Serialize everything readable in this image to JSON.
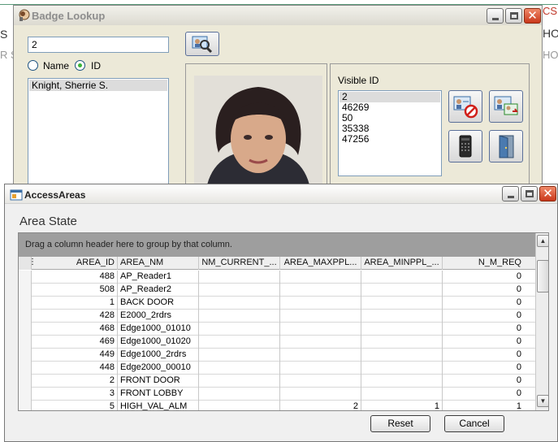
{
  "background_app": {
    "left_top": "S",
    "left_bottom": "R S",
    "right_top": "CS",
    "right_mid": "HO",
    "right_bottom": "HO"
  },
  "badge_lookup": {
    "title": "Badge Lookup",
    "search_value": "2",
    "radio_name_label": "Name",
    "radio_id_label": "ID",
    "selected_mode": "ID",
    "names": [
      "Knight, Sherrie S."
    ],
    "visible_id_label": "Visible ID",
    "visible_ids": [
      "2",
      "46269",
      "50",
      "35338",
      "47256"
    ]
  },
  "access_areas": {
    "title": "AccessAreas",
    "section_title": "Area State",
    "group_hint": "Drag a column header here to group by that column.",
    "columns": [
      "AREA_ID",
      "AREA_NM",
      "NM_CURRENT_...",
      "AREA_MAXPPL...",
      "AREA_MINPPL_...",
      "N_M_REQ"
    ],
    "rows": [
      [
        "488",
        "AP_Reader1",
        "",
        "",
        "",
        "0"
      ],
      [
        "508",
        "AP_Reader2",
        "",
        "",
        "",
        "0"
      ],
      [
        "1",
        "BACK DOOR",
        "",
        "",
        "",
        "0"
      ],
      [
        "428",
        "E2000_2rdrs",
        "",
        "",
        "",
        "0"
      ],
      [
        "468",
        "Edge1000_01010",
        "",
        "",
        "",
        "0"
      ],
      [
        "469",
        "Edge1000_01020",
        "",
        "",
        "",
        "0"
      ],
      [
        "449",
        "Edge1000_2rdrs",
        "",
        "",
        "",
        "0"
      ],
      [
        "448",
        "Edge2000_00010",
        "",
        "",
        "",
        "0"
      ],
      [
        "2",
        "FRONT DOOR",
        "",
        "",
        "",
        "0"
      ],
      [
        "3",
        "FRONT LOBBY",
        "",
        "",
        "",
        "0"
      ],
      [
        "5",
        "HIGH_VAL_ALM",
        "",
        "2",
        "1",
        "1"
      ]
    ],
    "reset_label": "Reset",
    "cancel_label": "Cancel"
  },
  "colors": {
    "close_button": "#c9371a",
    "radio_selected": "#3ab33a",
    "group_panel": "#9e9e9e"
  },
  "icons": [
    "app-icon",
    "magnifier-icon",
    "badge-deny-icon",
    "badge-transfer-icon",
    "card-reader-icon",
    "door-icon",
    "window-icon"
  ]
}
